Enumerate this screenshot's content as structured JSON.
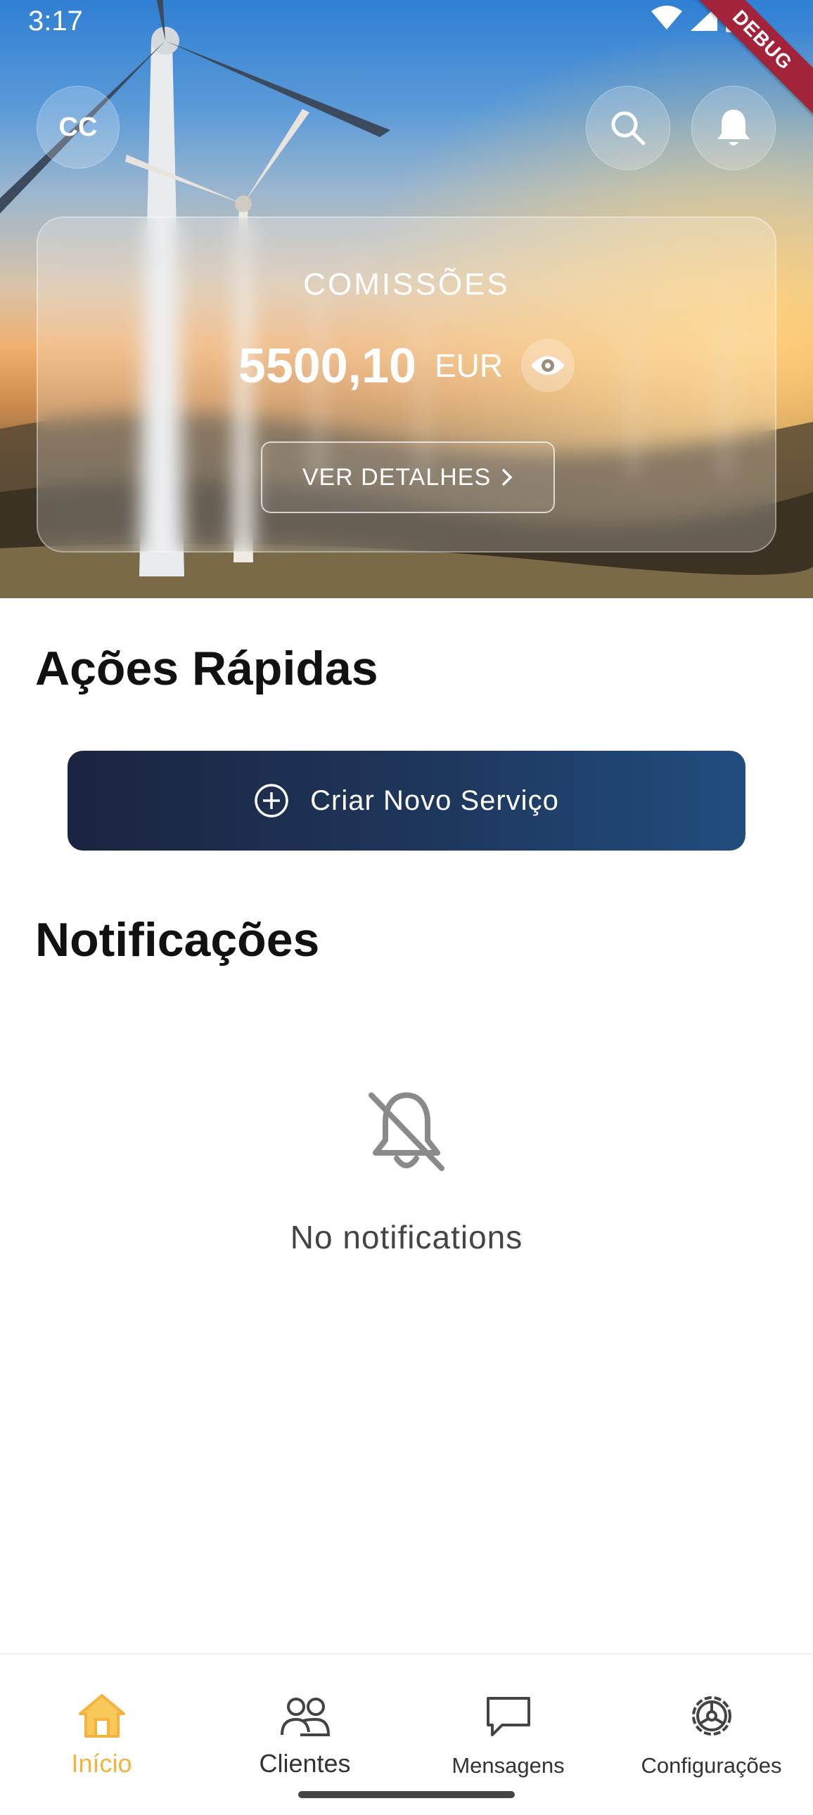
{
  "status_bar": {
    "time": "3:17"
  },
  "debug_banner": "DEBUG",
  "header": {
    "avatar_initials": "CC"
  },
  "commissions_card": {
    "title": "COMISSÕES",
    "amount": "5500,10",
    "currency": "EUR",
    "details_button": "VER DETALHES"
  },
  "quick_actions": {
    "title": "Ações Rápidas",
    "create_service_button": "Criar Novo Serviço"
  },
  "notifications": {
    "title": "Notificações",
    "empty_message": "No notifications"
  },
  "bottom_nav": {
    "items": [
      {
        "label": "Início",
        "icon": "home-icon",
        "active": true
      },
      {
        "label": "Clientes",
        "icon": "users-icon",
        "active": false
      },
      {
        "label": "Mensagens",
        "icon": "chat-icon",
        "active": false
      },
      {
        "label": "Configurações",
        "icon": "settings-icon",
        "active": false
      }
    ]
  },
  "colors": {
    "accent": "#f5b33d",
    "primary_gradient_start": "#1b2440",
    "primary_gradient_end": "#214d7f",
    "debug_ribbon": "#a3243a"
  }
}
